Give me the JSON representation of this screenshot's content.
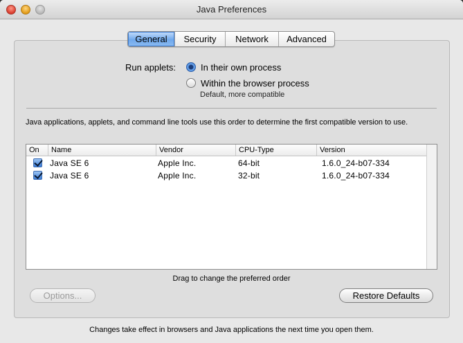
{
  "window": {
    "title": "Java Preferences"
  },
  "tabs": [
    {
      "label": "General",
      "active": true
    },
    {
      "label": "Security",
      "active": false
    },
    {
      "label": "Network",
      "active": false
    },
    {
      "label": "Advanced",
      "active": false
    }
  ],
  "run_applets": {
    "label": "Run applets:",
    "options": [
      {
        "label": "In their own process",
        "selected": true
      },
      {
        "label": "Within the browser process",
        "selected": false
      }
    ],
    "note": "Default, more compatible"
  },
  "description": "Java applications, applets, and command line tools use this order to determine the first compatible version to use.",
  "table": {
    "columns": [
      "On",
      "Name",
      "Vendor",
      "CPU-Type",
      "Version"
    ],
    "rows": [
      {
        "on": true,
        "name": "Java SE 6",
        "vendor": "Apple Inc.",
        "cpu": "64-bit",
        "version": "1.6.0_24-b07-334"
      },
      {
        "on": true,
        "name": "Java SE 6",
        "vendor": "Apple Inc.",
        "cpu": "32-bit",
        "version": "1.6.0_24-b07-334"
      }
    ]
  },
  "drag_note": "Drag to change the preferred order",
  "buttons": {
    "options": "Options...",
    "restore": "Restore Defaults"
  },
  "footer": "Changes take effect in browsers and Java applications the next time you open them.",
  "colors": {
    "selected_tab": "#6fa8ec",
    "window_bg": "#e8e8e8"
  }
}
